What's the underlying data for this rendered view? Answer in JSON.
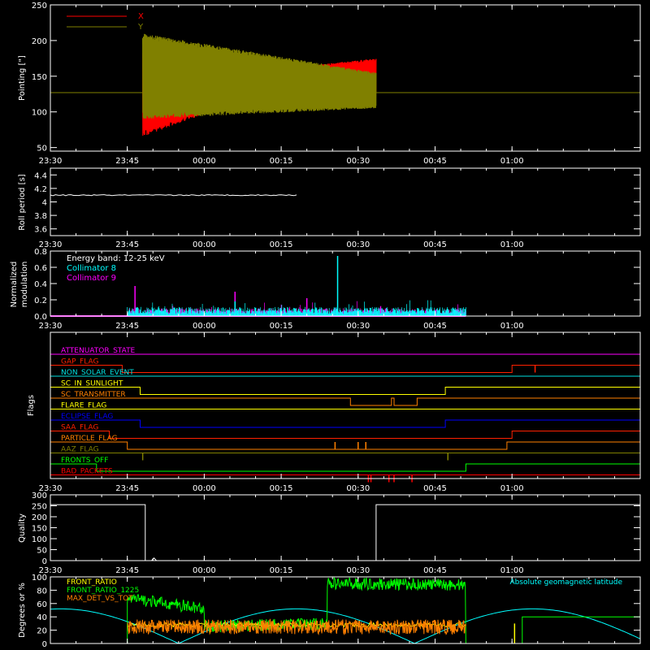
{
  "colors": {
    "background": "#000000",
    "axes": "#ffffff",
    "x_series": "#ff0000",
    "y_series": "#808000",
    "collimator8": "#00ffff",
    "collimator9": "#ff00ff",
    "front_ratio": "#00ff00",
    "front_ratio_1225": "#00ff00",
    "max_det_vs_tot": "#ff8000",
    "geomag": "#00ffff",
    "text_white": "#ffffff"
  },
  "chart_data": [
    {
      "type": "line",
      "id": "pointing",
      "ylabel": "Pointing [\"]",
      "ylim": [
        45,
        250
      ],
      "yticks": [
        50,
        100,
        150,
        200,
        250
      ],
      "xlim_minutes": [
        -30,
        85
      ],
      "xtick_labels": [
        "23:30",
        "23:45",
        "00:00",
        "00:15",
        "00:30",
        "00:45",
        "01:00"
      ],
      "xtick_minutes": [
        -30,
        -15,
        0,
        15,
        30,
        45,
        60
      ],
      "legend": [
        {
          "name": "X",
          "color": "#ff0000"
        },
        {
          "name": "Y",
          "color": "#808000"
        }
      ],
      "baseline_value": 127,
      "series": [
        {
          "name": "X",
          "start_min": -12,
          "end_min": 33.5,
          "center_start": 128,
          "center_end": 150,
          "amp_start": 63,
          "amp_mid_min": 18,
          "amp_end": 25
        },
        {
          "name": "Y",
          "start_min": -12,
          "end_min": 33.5,
          "center_start": 150,
          "center_end": 130,
          "amp_start": 60,
          "amp_end": 25
        }
      ]
    },
    {
      "type": "line",
      "id": "roll",
      "ylabel": "Roll period [s]",
      "ylim": [
        3.5,
        4.5
      ],
      "yticks": [
        3.6,
        3.8,
        4.0,
        4.2,
        4.4
      ],
      "xtick_labels": [
        "23:30",
        "23:45",
        "00:00",
        "00:15",
        "00:30",
        "00:45",
        "01:00"
      ],
      "series": [
        {
          "name": "",
          "start_min": -30,
          "end_min": 18,
          "value": 4.1
        }
      ]
    },
    {
      "type": "bar",
      "id": "modulation",
      "ylabel": "Normalized modulation",
      "ylim": [
        0,
        0.8
      ],
      "yticks": [
        0.0,
        0.2,
        0.4,
        0.6,
        0.8
      ],
      "ytick_labels": [
        "0.0",
        "0.2",
        "0.4",
        "0.6",
        "0.8"
      ],
      "xtick_labels": [
        "23:30",
        "23:45",
        "00:00",
        "00:15",
        "00:30",
        "00:45",
        "01:00"
      ],
      "annotations": [
        "Energy band: 12-25 keV",
        "Collimator 8",
        "Collimator 9"
      ],
      "series": [
        {
          "name": "Collimator 8",
          "start_min": -15,
          "end_min": 51,
          "typical": 0.07,
          "spikes": [
            {
              "min": 26,
              "value": 0.74
            },
            {
              "min": 6,
              "value": 0.18
            }
          ]
        },
        {
          "name": "Collimator 9",
          "start_min": -15,
          "end_min": 51,
          "typical": 0.06,
          "spikes": [
            {
              "min": -13.5,
              "value": 0.37
            },
            {
              "min": 6,
              "value": 0.3
            },
            {
              "min": 20,
              "value": 0.22
            }
          ]
        }
      ]
    },
    {
      "type": "line",
      "id": "flags",
      "ylabel": "Flags",
      "xtick_labels": [
        "23:30",
        "23:45",
        "00:00",
        "00:15",
        "00:30",
        "00:45",
        "01:00"
      ],
      "flags": [
        {
          "label": "ATTENUATOR_STATE",
          "color": "#ff00ff",
          "transitions": []
        },
        {
          "label": "GAP_FLAG",
          "color": "#ff2000",
          "transitions": [
            -16,
            60
          ],
          "spikes": [
            64.5
          ]
        },
        {
          "label": "NON_SOLAR_EVENT",
          "color": "#00e0e0",
          "transitions": []
        },
        {
          "label": "SC_IN_SUNLIGHT",
          "color": "#ffff00",
          "transitions": [
            -12.5,
            47
          ]
        },
        {
          "label": "SC_TRANSMITTER",
          "color": "#ff8000",
          "transitions": [
            28.5,
            36.5,
            37,
            41.5
          ]
        },
        {
          "label": "FLARE_FLAG",
          "color": "#ffff00",
          "transitions": []
        },
        {
          "label": "ECLIPSE_FLAG",
          "color": "#0000ff",
          "transitions": [
            -12.5,
            47
          ]
        },
        {
          "label": "SAA_FLAG",
          "color": "#ff2000",
          "transitions": [
            -18.5,
            60
          ]
        },
        {
          "label": "PARTICLE_FLAG",
          "color": "#ff8000",
          "transitions": [
            -15,
            59
          ],
          "spikes": [
            25.5,
            30,
            31.5
          ]
        },
        {
          "label": "AAZ_FLAG",
          "color": "#808000",
          "transitions": [],
          "spikes": [
            -12,
            47.5
          ]
        },
        {
          "label": "FRONTS_OFF",
          "color": "#00ff00",
          "transitions": [
            -21,
            51
          ]
        },
        {
          "label": "BAD_PACKETS",
          "color": "#ff0000",
          "transitions": [],
          "spikes": [
            32,
            32.5,
            36,
            37,
            40.5
          ]
        }
      ]
    },
    {
      "type": "line",
      "id": "quality",
      "ylabel": "Quality",
      "ylim": [
        0,
        300
      ],
      "yticks": [
        0,
        50,
        100,
        150,
        200,
        250,
        300
      ],
      "xtick_labels": [
        "23:30",
        "23:45",
        "00:00",
        "00:15",
        "00:30",
        "00:45",
        "01:00"
      ],
      "series": [
        {
          "name": "",
          "segments": [
            [
              -30,
              -11.5,
              255
            ],
            [
              -11.5,
              33.5,
              0
            ],
            [
              33.5,
              85,
              255
            ]
          ],
          "blips": [
            {
              "min": -9.8,
              "value": 12
            }
          ]
        }
      ]
    },
    {
      "type": "line",
      "id": "ratios",
      "ylabel": "Degrees or %",
      "ylim": [
        0,
        100
      ],
      "yticks": [
        0,
        20,
        40,
        60,
        80,
        100
      ],
      "xtick_labels": [
        "23:30",
        "23:45",
        "00:00",
        "00:15",
        "00:30",
        "00:45",
        "01:00"
      ],
      "legend": [
        {
          "name": "FRONT_RATIO",
          "color": "#ffff00"
        },
        {
          "name": "FRONT_RATIO_1225",
          "color": "#00ff00"
        },
        {
          "name": "MAX_DET_VS_TOT",
          "color": "#ff8000"
        }
      ],
      "annotation": "Absolute geomagnetic latitude",
      "series": [
        {
          "name": "FRONT_RATIO",
          "start_min": -15,
          "end_min": 51,
          "value": 28
        },
        {
          "name": "FRONT_RATIO_1225",
          "start_min": -15,
          "end_min": 51,
          "segments": [
            [
              -15,
              0,
              68,
              52
            ],
            [
              0,
              24,
              25,
              30
            ],
            [
              24,
              51,
              90,
              88
            ]
          ]
        },
        {
          "name": "MAX_DET_VS_TOT",
          "start_min": -15,
          "end_min": 51,
          "value": 25
        },
        {
          "name": "Absolute geomagnetic latitude",
          "start_min": -30,
          "end_min": 85,
          "amp": 52,
          "period_min": 92,
          "phase_min": -5
        }
      ]
    }
  ]
}
